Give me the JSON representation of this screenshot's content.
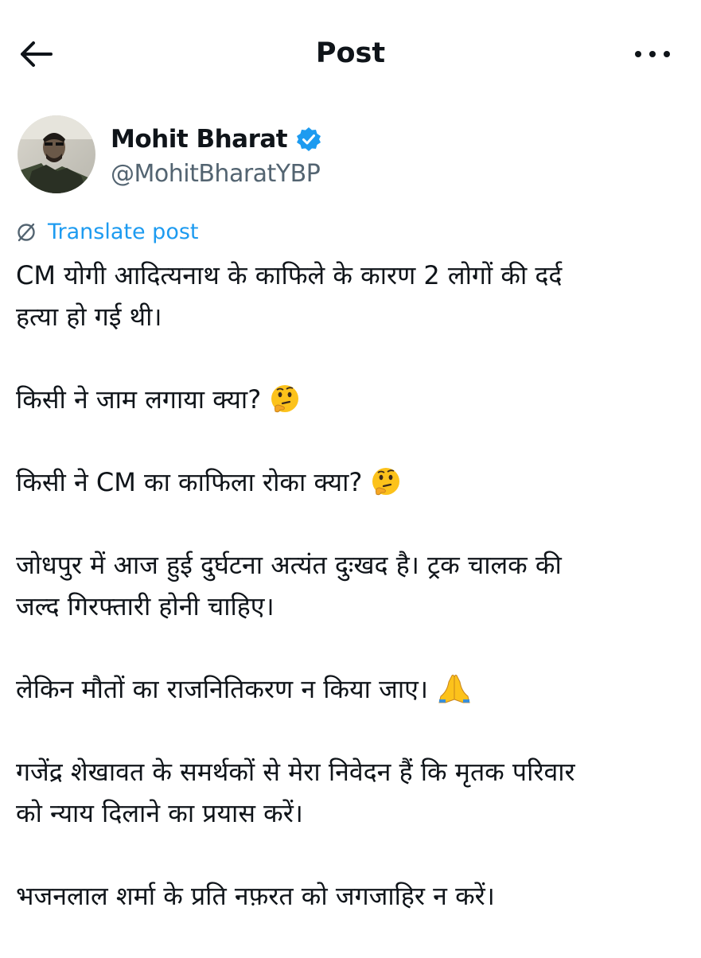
{
  "header": {
    "title": "Post",
    "back_icon": "arrow-left-icon",
    "more_icon": "more-horizontal-icon"
  },
  "author": {
    "display_name": "Mohit Bharat",
    "handle": "@MohitBharatYBP",
    "verified": true,
    "verified_color": "#1d9bf0"
  },
  "translate": {
    "label": "Translate post",
    "icon": "translate-globe-icon",
    "color": "#1d9bf0"
  },
  "post": {
    "paragraphs": [
      {
        "lines": [
          "CM योगी आदित्यनाथ के काफिले के कारण 2 लोगों की दर्द",
          "हत्या हो गई थी।"
        ]
      },
      {
        "lines": [
          "किसी ने जाम लगाया क्या?"
        ],
        "emoji": "thinking-face-emoji"
      },
      {
        "lines": [
          "किसी ने CM का काफिला रोका क्या?"
        ],
        "emoji": "thinking-face-emoji"
      },
      {
        "lines": [
          "जोधपुर में आज हुई दुर्घटना अत्यंत दुःखद है। ट्रक चालक की",
          "जल्द गिरफ्तारी होनी चाहिए।"
        ]
      },
      {
        "lines": [
          "लेकिन मौतों का राजनितिकरण न किया जाए।"
        ],
        "emoji": "folded-hands-emoji"
      },
      {
        "lines": [
          "गजेंद्र शेखावत के समर्थकों से मेरा निवेदन हैं कि मृतक परिवार",
          "को न्याय दिलाने का प्रयास करें।"
        ]
      },
      {
        "lines": [
          "भजनलाल शर्मा के प्रति नफ़रत को जगजाहिर न करें।"
        ]
      }
    ]
  }
}
